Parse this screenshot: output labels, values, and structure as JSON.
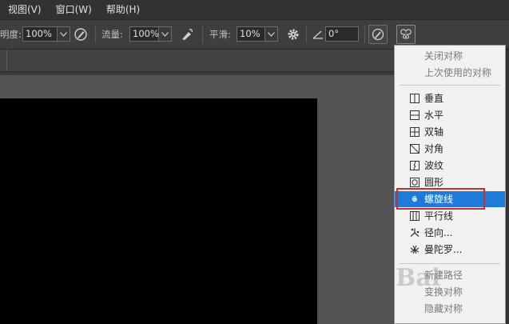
{
  "menubar": {
    "items": [
      {
        "label": "视图(V)"
      },
      {
        "label": "窗口(W)"
      },
      {
        "label": "帮助(H)"
      }
    ]
  },
  "options": {
    "opacity_label_partial": "明度:",
    "opacity_value": "100%",
    "flow_label": "流量:",
    "flow_value": "100%",
    "smooth_label": "平滑:",
    "smooth_value": "10%",
    "angle_value": "0°",
    "icons": {
      "pressure_opacity": "pen-pressure-icon",
      "airbrush": "airbrush-icon",
      "smoothing_options": "gear-icon",
      "angle": "angle-icon",
      "pressure_size": "pen-pressure-size-icon",
      "symmetry": "butterfly-symmetry-icon"
    }
  },
  "symmetry_menu": {
    "items": [
      {
        "label": "关闭对称",
        "disabled": true,
        "icon": ""
      },
      {
        "label": "上次使用的对称",
        "disabled": true,
        "icon": ""
      },
      {
        "label": "垂直",
        "disabled": false,
        "icon": "vertical-icon"
      },
      {
        "label": "水平",
        "disabled": false,
        "icon": "horizontal-icon"
      },
      {
        "label": "双轴",
        "disabled": false,
        "icon": "dual-axis-icon"
      },
      {
        "label": "对角",
        "disabled": false,
        "icon": "diagonal-icon"
      },
      {
        "label": "波纹",
        "disabled": false,
        "icon": "wavy-icon"
      },
      {
        "label": "圆形",
        "disabled": false,
        "icon": "circle-icon"
      },
      {
        "label": "螺旋线",
        "disabled": false,
        "icon": "spiral-icon",
        "selected": true
      },
      {
        "label": "平行线",
        "disabled": false,
        "icon": "parallel-lines-icon"
      },
      {
        "label": "径向...",
        "disabled": false,
        "icon": "radial-icon"
      },
      {
        "label": "曼陀罗...",
        "disabled": false,
        "icon": "mandala-icon"
      },
      {
        "label": "新建路径",
        "disabled": true,
        "icon": ""
      },
      {
        "label": "变换对称",
        "disabled": true,
        "icon": ""
      },
      {
        "label": "隐藏对称",
        "disabled": true,
        "icon": ""
      }
    ]
  },
  "colors": {
    "selection": "#1f7bd9",
    "highlight_frame": "#d02a2a"
  },
  "watermark": "Bai"
}
